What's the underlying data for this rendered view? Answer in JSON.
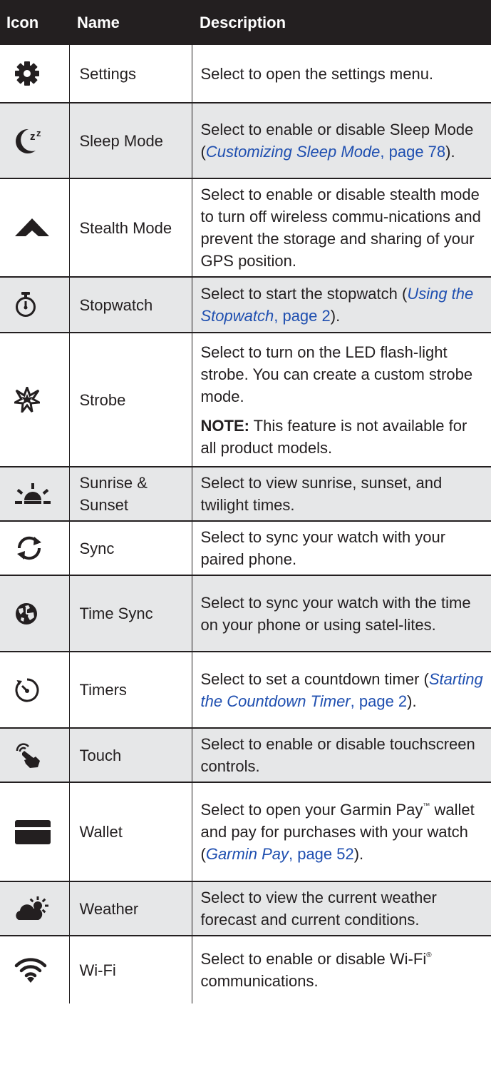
{
  "headers": {
    "icon": "Icon",
    "name": "Name",
    "description": "Description"
  },
  "rows": [
    {
      "icon": "gear-icon",
      "name": "Settings",
      "desc": "Select to open the settings menu."
    },
    {
      "icon": "sleep-moon-icon",
      "name": "Sleep Mode",
      "desc_pre": "Select to enable or disable Sleep Mode (",
      "link_title": "Customizing Sleep Mode",
      "link_page": ", page 78",
      "desc_post": ")."
    },
    {
      "icon": "stealth-icon",
      "name": "Stealth Mode",
      "desc": "Select to enable or disable stealth mode to turn off wireless commu-nications and prevent the storage and sharing of your GPS position."
    },
    {
      "icon": "stopwatch-icon",
      "name": "Stopwatch",
      "desc_pre": "Select to start the stopwatch (",
      "link_title": "Using the Stopwatch",
      "link_page": ", page 2",
      "desc_post": ")."
    },
    {
      "icon": "strobe-icon",
      "name": "Strobe",
      "desc": "Select to turn on the LED flash-light strobe. You can create a custom strobe mode.",
      "note_label": "NOTE:",
      "note_text": " This feature is not available for all product models."
    },
    {
      "icon": "sunrise-sunset-icon",
      "name": "Sunrise & Sunset",
      "desc": "Select to view sunrise, sunset, and twilight times."
    },
    {
      "icon": "sync-icon",
      "name": "Sync",
      "desc": "Select to sync your watch with your paired phone."
    },
    {
      "icon": "globe-icon",
      "name": "Time Sync",
      "desc": "Select to sync your watch with the time on your phone or using satel-lites."
    },
    {
      "icon": "timer-icon",
      "name": "Timers",
      "desc_pre": "Select to set a countdown timer (",
      "link_title": "Starting the Countdown Timer",
      "link_page": ", page 2",
      "desc_post": ")."
    },
    {
      "icon": "touch-hand-icon",
      "name": "Touch",
      "desc": "Select to enable or disable touchscreen controls."
    },
    {
      "icon": "wallet-card-icon",
      "name": "Wallet",
      "desc_pre": "Select to open your Garmin Pay",
      "tm": "™",
      "desc_mid": " wallet and pay for purchases with your watch (",
      "link_title": "Garmin Pay",
      "link_page": ", page 52",
      "desc_post": ")."
    },
    {
      "icon": "weather-icon",
      "name": "Weather",
      "desc": "Select to view the current weather forecast and current conditions."
    },
    {
      "icon": "wifi-icon",
      "name": "Wi-Fi",
      "desc_pre": "Select to enable or disable Wi-Fi",
      "reg": "®",
      "desc_post": " communications."
    }
  ]
}
